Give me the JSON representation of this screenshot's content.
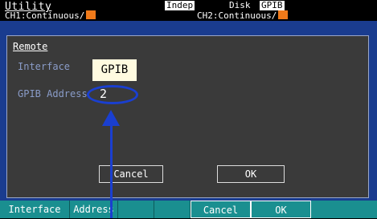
{
  "header": {
    "title": "Utility",
    "indep": "Indep",
    "disk": "Disk",
    "gpib_status": "GPIB",
    "ch1": "CH1:Continuous/",
    "ch2": "CH2:Continuous/"
  },
  "dialog": {
    "title": "Remote",
    "interface_label": "Interface",
    "interface_value": "GPIB",
    "address_label": "GPIB Address",
    "address_value": "2",
    "cancel_label": "Cancel",
    "ok_label": "OK"
  },
  "softkeys": [
    "Interface",
    "Address",
    "",
    "",
    "Cancel",
    "OK",
    ""
  ],
  "colors": {
    "channel_swatch": "#f07a1a",
    "highlight": "#1a3fd0",
    "softkey_bar": "#1a8f90"
  }
}
